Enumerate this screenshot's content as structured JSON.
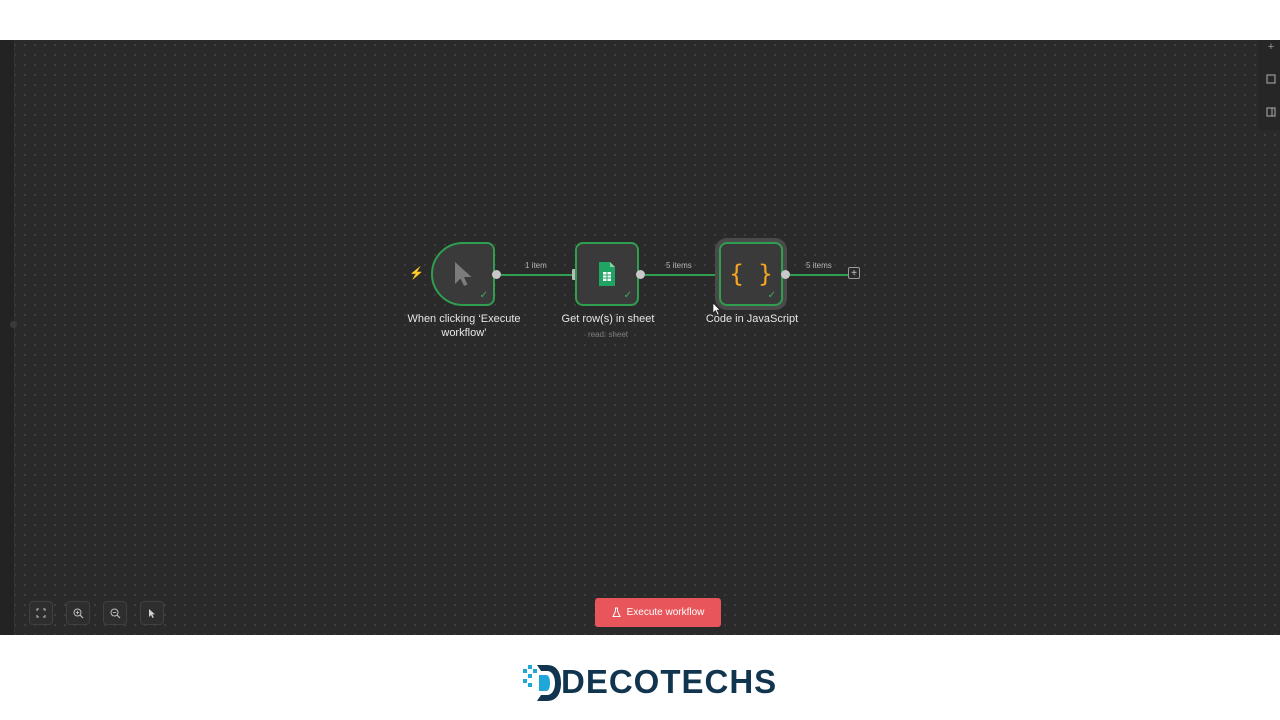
{
  "nodes": [
    {
      "label": "When clicking ‘Execute workflow’",
      "icon": "cursor-icon"
    },
    {
      "label": "Get row(s) in sheet",
      "sublabel": "read: sheet",
      "icon": "google-sheets-icon"
    },
    {
      "label": "Code in JavaScript",
      "icon": "code-braces-icon",
      "glyph": "{ }"
    }
  ],
  "edges": [
    {
      "label": "1 item"
    },
    {
      "label": "5 items"
    },
    {
      "label": "5 items"
    }
  ],
  "toolbar": {
    "execute_label": "Execute workflow"
  },
  "brand": {
    "name": "DECOTECHS",
    "color": "#12354f",
    "accent": "#1ea7d8"
  },
  "colors": {
    "success": "#2f9e50",
    "execute": "#e8555a",
    "code_icon": "#f5a623"
  }
}
